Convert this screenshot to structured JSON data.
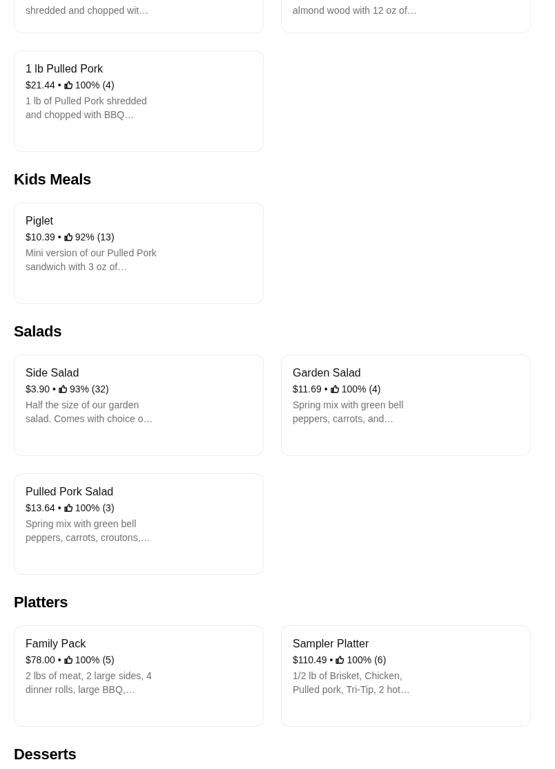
{
  "sections": [
    {
      "items": [
        {
          "kind": "partial",
          "description": "shredded and chopped wit…"
        },
        {
          "kind": "partial",
          "description": "almond wood with 12 oz of…"
        },
        {
          "kind": "full",
          "name": "1 lb Pulled Pork",
          "price": "$21.44",
          "dot": "•",
          "rating": "100% (4)",
          "description": "1 lb of Pulled Pork shredded and chopped with BBQ…"
        }
      ]
    },
    {
      "title": "Kids Meals",
      "items": [
        {
          "kind": "full",
          "name": "Piglet",
          "price": "$10.39",
          "dot": "•",
          "rating": "92% (13)",
          "description": "Mini version of our Pulled Pork sandwich with 3 oz of…"
        }
      ]
    },
    {
      "title": "Salads",
      "items": [
        {
          "kind": "full",
          "name": "Side Salad",
          "price": "$3.90",
          "dot": "•",
          "rating": "93% (32)",
          "description": "Half the size of our garden salad. Comes with choice o…"
        },
        {
          "kind": "full",
          "name": "Garden Salad",
          "price": "$11.69",
          "dot": "•",
          "rating": "100% (4)",
          "description": "Spring mix with green bell peppers, carrots, and…"
        },
        {
          "kind": "full",
          "name": "Pulled Pork Salad",
          "price": "$13.64",
          "dot": "•",
          "rating": "100% (3)",
          "description": "Spring mix with green bell peppers, carrots, croutons,…"
        }
      ]
    },
    {
      "title": "Platters",
      "items": [
        {
          "kind": "full",
          "name": "Family Pack",
          "price": "$78.00",
          "dot": "•",
          "rating": "100% (5)",
          "description": "2 lbs of meat, 2 large sides, 4 dinner rolls, large BBQ,…"
        },
        {
          "kind": "full",
          "name": "Sampler Platter",
          "price": "$110.49",
          "dot": "•",
          "rating": "100% (6)",
          "description": "1/2 lb of Brisket, Chicken, Pulled pork, Tri-Tip, 2 hot…"
        }
      ]
    },
    {
      "title": "Desserts"
    }
  ]
}
